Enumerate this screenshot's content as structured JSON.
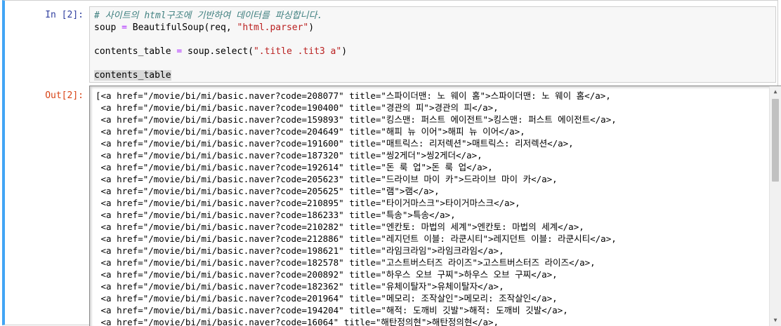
{
  "cell": {
    "in_prompt": "In [2]:",
    "out_prompt": "Out[2]:",
    "code": {
      "line1_comment": "# 사이트의 html구조에 기반하여 데이터를 파싱합니다.",
      "line2_a": "soup ",
      "line2_op": "=",
      "line2_b": " BeautifulSoup(req, ",
      "line2_str": "\"html.parser\"",
      "line2_c": ")",
      "line3": "",
      "line4_a": "contents_table ",
      "line4_op": "=",
      "line4_b": " soup.select(",
      "line4_str": "\".title .tit3 a\"",
      "line4_c": ")",
      "line5": "",
      "line6": "contents_table"
    },
    "output_lines": [
      "[<a href=\"/movie/bi/mi/basic.naver?code=208077\" title=\"스파이더맨: 노 웨이 홈\">스파이더맨: 노 웨이 홈</a>,",
      " <a href=\"/movie/bi/mi/basic.naver?code=190400\" title=\"경관의 피\">경관의 피</a>,",
      " <a href=\"/movie/bi/mi/basic.naver?code=159893\" title=\"킹스맨: 퍼스트 에이전트\">킹스맨: 퍼스트 에이전트</a>,",
      " <a href=\"/movie/bi/mi/basic.naver?code=204649\" title=\"해피 뉴 이어\">해피 뉴 이어</a>,",
      " <a href=\"/movie/bi/mi/basic.naver?code=191600\" title=\"매트릭스: 리저렉션\">매트릭스: 리저렉션</a>,",
      " <a href=\"/movie/bi/mi/basic.naver?code=187320\" title=\"씽2게더\">씽2게더</a>,",
      " <a href=\"/movie/bi/mi/basic.naver?code=192614\" title=\"돈 룩 업\">돈 룩 업</a>,",
      " <a href=\"/movie/bi/mi/basic.naver?code=205623\" title=\"드라이브 마이 카\">드라이브 마이 카</a>,",
      " <a href=\"/movie/bi/mi/basic.naver?code=205625\" title=\"램\">램</a>,",
      " <a href=\"/movie/bi/mi/basic.naver?code=210895\" title=\"타이거마스크\">타이거마스크</a>,",
      " <a href=\"/movie/bi/mi/basic.naver?code=186233\" title=\"특송\">특송</a>,",
      " <a href=\"/movie/bi/mi/basic.naver?code=210282\" title=\"엔칸토: 마법의 세계\">엔칸토: 마법의 세계</a>,",
      " <a href=\"/movie/bi/mi/basic.naver?code=212886\" title=\"레지던트 이블: 라쿤시티\">레지던트 이블: 라쿤시티</a>,",
      " <a href=\"/movie/bi/mi/basic.naver?code=198621\" title=\"라임크라임\">라임크라임</a>,",
      " <a href=\"/movie/bi/mi/basic.naver?code=182578\" title=\"고스트버스터즈 라이즈\">고스트버스터즈 라이즈</a>,",
      " <a href=\"/movie/bi/mi/basic.naver?code=200892\" title=\"하우스 오브 구찌\">하우스 오브 구찌</a>,",
      " <a href=\"/movie/bi/mi/basic.naver?code=182362\" title=\"유체이탈자\">유체이탈자</a>,",
      " <a href=\"/movie/bi/mi/basic.naver?code=201964\" title=\"메모리: 조작살인\">메모리: 조작살인</a>,",
      " <a href=\"/movie/bi/mi/basic.naver?code=194204\" title=\"해적: 도깨비 깃발\">해적: 도깨비 깃발</a>,",
      " <a href=\"/movie/bi/mi/basic.naver?code=16064\" title=\"해탄정의현\">해탄정의현</a>,"
    ],
    "scrollbar": {
      "up_icon": "▲",
      "down_icon": "▼",
      "scroll_fraction": 0.0
    }
  }
}
